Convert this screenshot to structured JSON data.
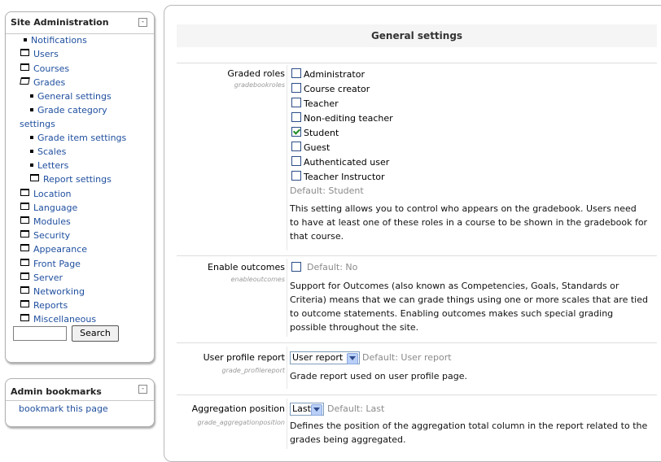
{
  "sidebar": {
    "title": "Site Administration",
    "toggle": "-",
    "items": [
      {
        "label": "Notifications",
        "icon": "bullet-icon"
      },
      {
        "label": "Users",
        "icon": "folder-icon"
      },
      {
        "label": "Courses",
        "icon": "folder-icon"
      },
      {
        "label": "Grades",
        "icon": "folder-open-icon"
      },
      {
        "label": "General settings",
        "icon": "bullet-icon"
      },
      {
        "label": "Grade category",
        "icon": "bullet-icon"
      },
      {
        "label": "settings",
        "icon": ""
      },
      {
        "label": "Grade item settings",
        "icon": "bullet-icon"
      },
      {
        "label": "Scales",
        "icon": "bullet-icon"
      },
      {
        "label": "Letters",
        "icon": "bullet-icon"
      },
      {
        "label": "Report settings",
        "icon": "folder-icon"
      },
      {
        "label": "Location",
        "icon": "folder-icon"
      },
      {
        "label": "Language",
        "icon": "folder-icon"
      },
      {
        "label": "Modules",
        "icon": "folder-icon"
      },
      {
        "label": "Security",
        "icon": "folder-icon"
      },
      {
        "label": "Appearance",
        "icon": "folder-icon"
      },
      {
        "label": "Front Page",
        "icon": "folder-icon"
      },
      {
        "label": "Server",
        "icon": "folder-icon"
      },
      {
        "label": "Networking",
        "icon": "folder-icon"
      },
      {
        "label": "Reports",
        "icon": "folder-icon"
      },
      {
        "label": "Miscellaneous",
        "icon": "folder-icon"
      }
    ],
    "search": {
      "value": "",
      "button_label": "Search"
    }
  },
  "bookmarks": {
    "title": "Admin bookmarks",
    "toggle": "-",
    "link_label": "bookmark this page"
  },
  "main": {
    "heading": "General settings",
    "graded_roles": {
      "label": "Graded roles",
      "sub": "gradebookroles",
      "roles": [
        {
          "label": "Administrator",
          "checked": false
        },
        {
          "label": "Course creator",
          "checked": false
        },
        {
          "label": "Teacher",
          "checked": false
        },
        {
          "label": "Non-editing teacher",
          "checked": false
        },
        {
          "label": "Student",
          "checked": true
        },
        {
          "label": "Guest",
          "checked": false
        },
        {
          "label": "Authenticated user",
          "checked": false
        },
        {
          "label": "Teacher Instructor",
          "checked": false
        }
      ],
      "default": "Default: Student",
      "desc": "This setting allows you to control who appears on the gradebook. Users need to have at least one of these roles in a course to be shown in the gradebook for that course."
    },
    "enable_outcomes": {
      "label": "Enable outcomes",
      "sub": "enableoutcomes",
      "checked": false,
      "default": "Default: No",
      "desc": "Support for Outcomes (also known as Competencies, Goals, Standards or Criteria) means that we can grade things using one or more scales that are tied to outcome statements. Enabling outcomes makes such special grading possible throughout the site."
    },
    "user_profile_report": {
      "label": "User profile report",
      "sub": "grade_profilereport",
      "selected": "User report",
      "default": "Default: User report",
      "desc": "Grade report used on user profile page."
    },
    "aggregation_position": {
      "label": "Aggregation position",
      "sub": "grade_aggregationposition",
      "selected": "Last",
      "default": "Default: Last",
      "desc": "Defines the position of the aggregation total column in the report related to the grades being aggregated."
    }
  }
}
